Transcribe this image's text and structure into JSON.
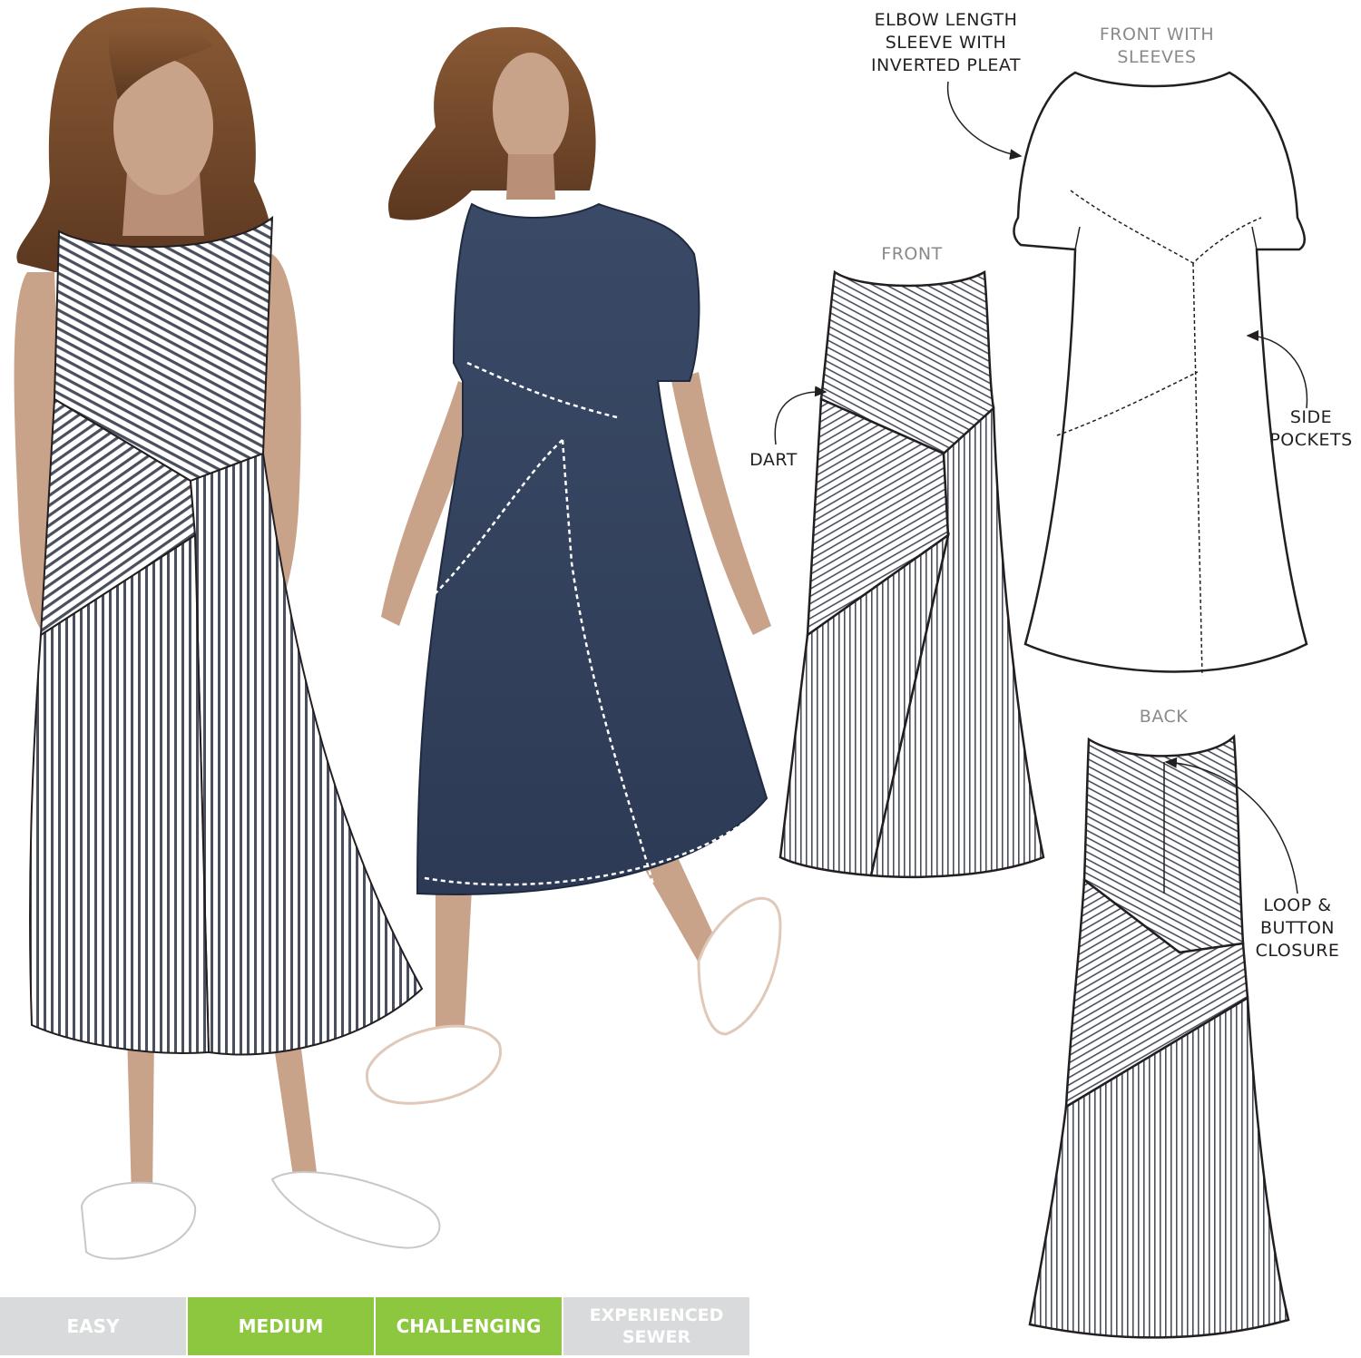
{
  "annotations": {
    "elbow_sleeve": [
      "ELBOW LENGTH",
      "SLEEVE WITH",
      "INVERTED PLEAT"
    ],
    "front_with_sleeves": [
      "FRONT WITH",
      "SLEEVES"
    ],
    "front": "FRONT",
    "dart": "DART",
    "side_pockets": [
      "SIDE",
      "POCKETS"
    ],
    "back": "BACK",
    "loop_button": [
      "LOOP &",
      "BUTTON",
      "CLOSURE"
    ]
  },
  "difficulty": {
    "levels": [
      {
        "label": "EASY",
        "active": false
      },
      {
        "label": "MEDIUM",
        "active": true
      },
      {
        "label": "CHALLENGING",
        "active": true
      },
      {
        "label": "EXPERIENCED SEWER",
        "active": false
      }
    ],
    "active_color": "#8dc63f",
    "inactive_color": "#d9dadb"
  },
  "colors": {
    "skin": "#c9a28a",
    "hair": "#7a4e2d",
    "navy_dress": "#34435f",
    "stripe": "#4a4f5e",
    "outline": "#231f20"
  }
}
